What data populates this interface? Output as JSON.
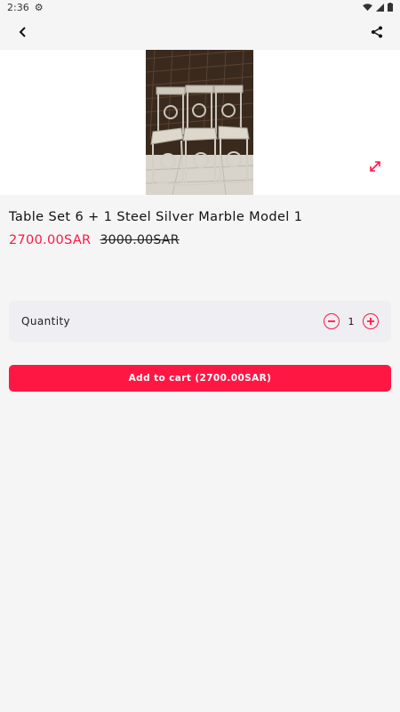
{
  "status_bar": {
    "time": "2:36",
    "settings_icon": "gear-icon",
    "wifi_icon": "wifi-icon",
    "signal_icon": "signal-icon",
    "battery_icon": "battery-icon"
  },
  "app_bar": {
    "back_icon": "back-arrow-icon",
    "share_icon": "share-icon"
  },
  "product": {
    "title": "Table Set 6 + 1 Steel Silver Marble Model 1",
    "price": "2700.00SAR",
    "original_price": "3000.00SAR",
    "image_icon": "product-photo",
    "zoom_icon": "expand-icon"
  },
  "quantity": {
    "label": "Quantity",
    "value": "1",
    "decrease_icon": "minus-circle-icon",
    "increase_icon": "plus-circle-icon"
  },
  "cart": {
    "button_label": "Add to cart (2700.00SAR)"
  },
  "colors": {
    "accent": "#ff1744",
    "background": "#f5f5f6",
    "card": "#efeef2"
  }
}
